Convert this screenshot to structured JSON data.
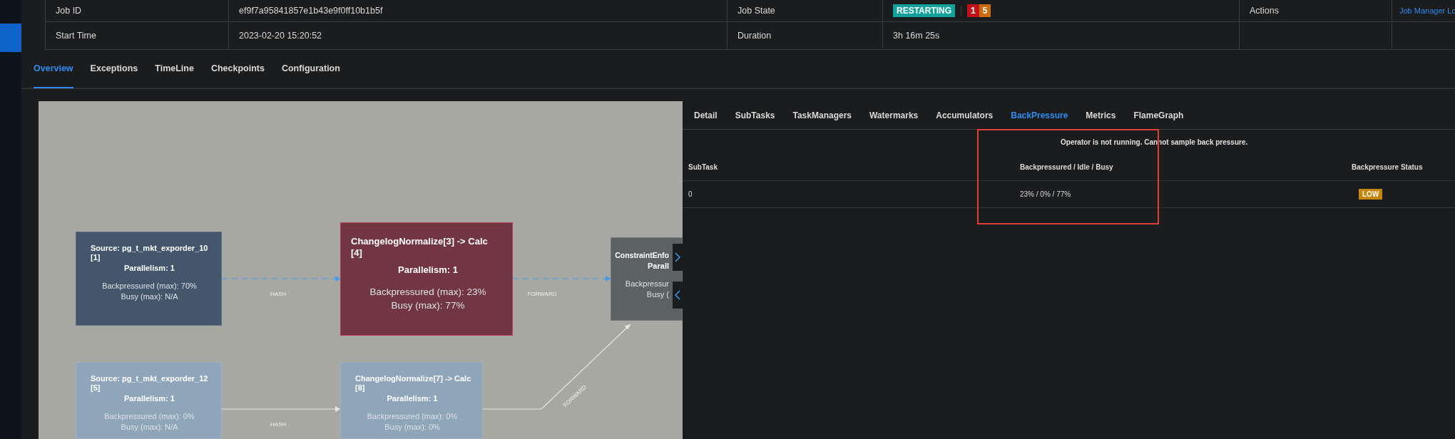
{
  "job_info": {
    "rows": [
      {
        "cells": [
          {
            "kind": "label",
            "text": "Job ID"
          },
          {
            "kind": "text",
            "text": "ef9f7a95841857e1b43e9f0ff10b1b5f"
          },
          {
            "kind": "label",
            "text": "Job State"
          },
          {
            "kind": "state",
            "status": "RESTARTING",
            "counts": [
              {
                "text": "1",
                "color": "#c0101a"
              },
              {
                "text": "5",
                "color": "#cc6a0e"
              }
            ]
          },
          {
            "kind": "label",
            "text": "Actions"
          },
          {
            "kind": "link",
            "text": "Job Manager Lo"
          }
        ]
      },
      {
        "cells": [
          {
            "kind": "label",
            "text": "Start Time"
          },
          {
            "kind": "text",
            "text": "2023-02-20 15:20:52"
          },
          {
            "kind": "label",
            "text": "Duration"
          },
          {
            "kind": "text",
            "text": "3h 16m 25s"
          },
          {
            "kind": "empty"
          },
          {
            "kind": "empty"
          }
        ]
      }
    ]
  },
  "tabs": [
    {
      "label": "Overview",
      "selected": true
    },
    {
      "label": "Exceptions",
      "selected": false
    },
    {
      "label": "TimeLine",
      "selected": false
    },
    {
      "label": "Checkpoints",
      "selected": false
    },
    {
      "label": "Configuration",
      "selected": false
    }
  ],
  "graph": {
    "nodes": [
      {
        "title_lines": [
          "Source: pg_t_mkt_exporder_10",
          "[1]"
        ],
        "parallelism": "Parallelism: 1",
        "backpressured": "Backpressured (max): 70%",
        "busy": "Busy (max): N/A",
        "color": "#43566b"
      },
      {
        "title_lines": [
          "ChangelogNormalize[3] -> Calc",
          "[4]"
        ],
        "parallelism": "Parallelism: 1",
        "backpressured": "Backpressured (max): 23%",
        "busy": "Busy (max): 77%",
        "color": "#723642"
      },
      {
        "title_lines": [
          "ConstraintEnfo"
        ],
        "parallelism": "Parall",
        "backpressured": "Backpressur",
        "busy": "Busy (",
        "color": "#5c6163"
      },
      {
        "title_lines": [
          "Source: pg_t_mkt_exporder_12",
          "[5]"
        ],
        "parallelism": "Parallelism: 1",
        "backpressured": "Backpressured (max): 0%",
        "busy": "Busy (max): N/A",
        "color": "#8ea5ba"
      },
      {
        "title_lines": [
          "ChangelogNormalize[7] -> Calc",
          "[8]"
        ],
        "parallelism": "Parallelism: 1",
        "backpressured": "Backpressured (max): 0%",
        "busy": "Busy (max): 0%",
        "color": "#8ea5ba"
      }
    ],
    "edges": [
      {
        "label": "HASH",
        "kind": "dashed"
      },
      {
        "label": "FORWARD",
        "kind": "dashed"
      },
      {
        "label": "HASH",
        "kind": "solid"
      },
      {
        "label": "FORWARD",
        "kind": "solid"
      }
    ]
  },
  "detail": {
    "tabs": [
      {
        "label": "Detail",
        "selected": false
      },
      {
        "label": "SubTasks",
        "selected": false
      },
      {
        "label": "TaskManagers",
        "selected": false
      },
      {
        "label": "Watermarks",
        "selected": false
      },
      {
        "label": "Accumulators",
        "selected": false
      },
      {
        "label": "BackPressure",
        "selected": true
      },
      {
        "label": "Metrics",
        "selected": false
      },
      {
        "label": "FlameGraph",
        "selected": false
      }
    ],
    "message": "Operator is not running. Cannot sample back pressure.",
    "table": {
      "columns": [
        "SubTask",
        "Backpressured / Idle / Busy",
        "Backpressure Status"
      ],
      "rows": [
        {
          "subtask": "0",
          "ratio": "23% / 0% / 77%",
          "status": "LOW"
        }
      ]
    }
  }
}
